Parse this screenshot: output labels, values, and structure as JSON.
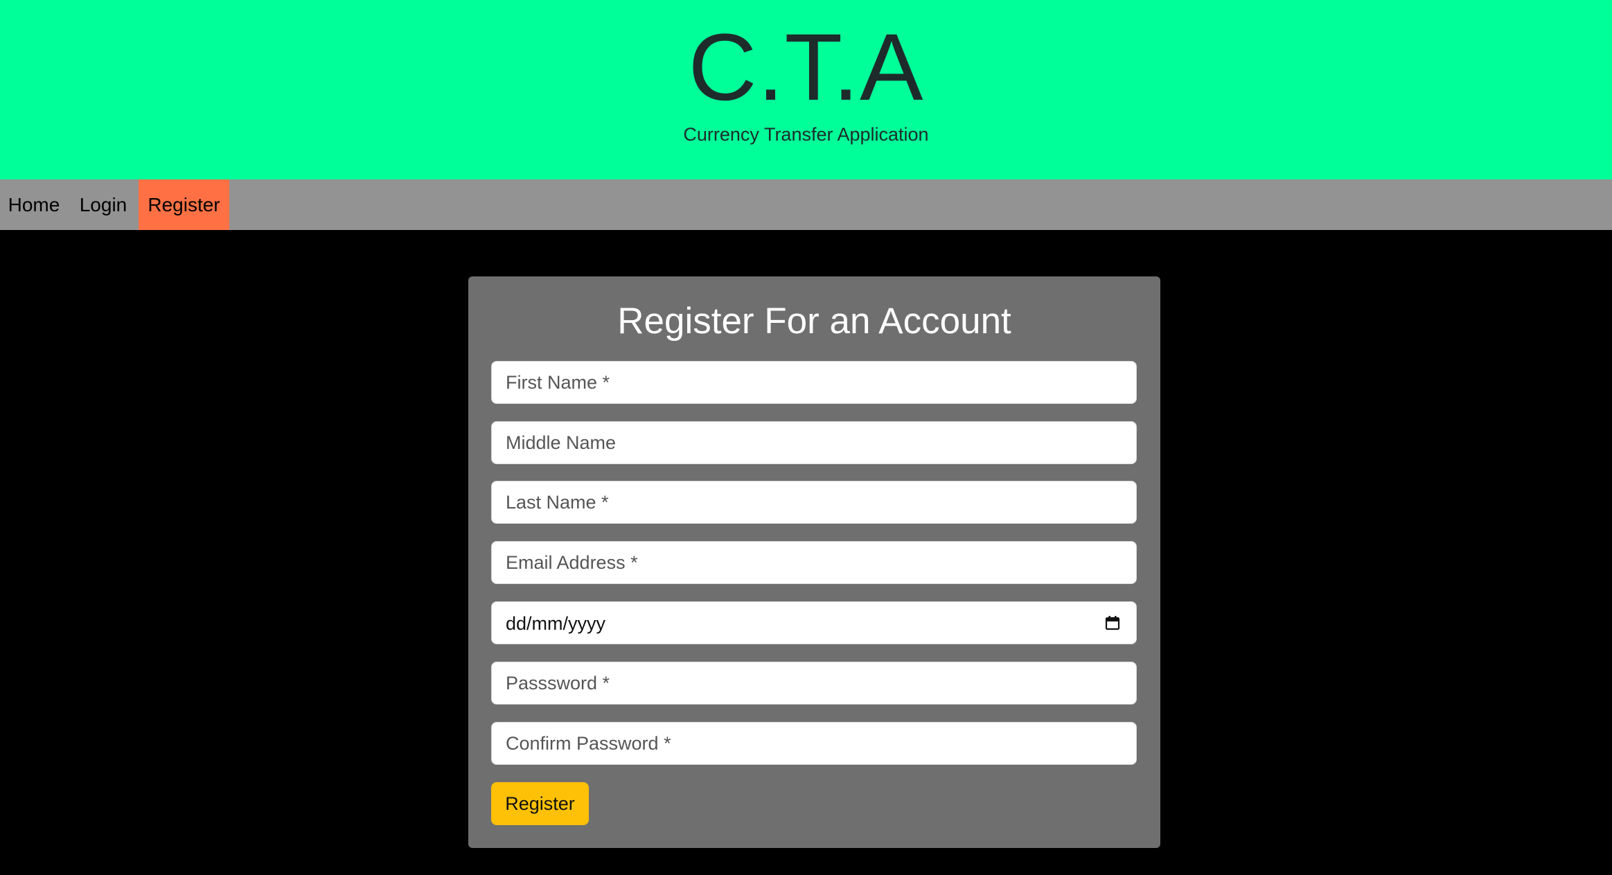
{
  "header": {
    "logo": "C.T.A",
    "tagline": "Currency Transfer Application",
    "background_color": "#00ff99"
  },
  "nav": {
    "items": [
      {
        "label": "Home",
        "active": false
      },
      {
        "label": "Login",
        "active": false
      },
      {
        "label": "Register",
        "active": true
      }
    ],
    "active_color": "#ff7144"
  },
  "form": {
    "title": "Register For an Account",
    "fields": {
      "first_name": {
        "placeholder": "First Name *",
        "value": ""
      },
      "middle_name": {
        "placeholder": "Middle Name",
        "value": ""
      },
      "last_name": {
        "placeholder": "Last Name *",
        "value": ""
      },
      "email": {
        "placeholder": "Email Address *",
        "value": ""
      },
      "date_of_birth": {
        "display": "dd/mm/yyyy",
        "icon": "calendar-icon"
      },
      "password": {
        "placeholder": "Passsword *",
        "value": ""
      },
      "confirm_password": {
        "placeholder": "Confirm Password *",
        "value": ""
      }
    },
    "submit_label": "Register",
    "submit_color": "#ffc107"
  }
}
